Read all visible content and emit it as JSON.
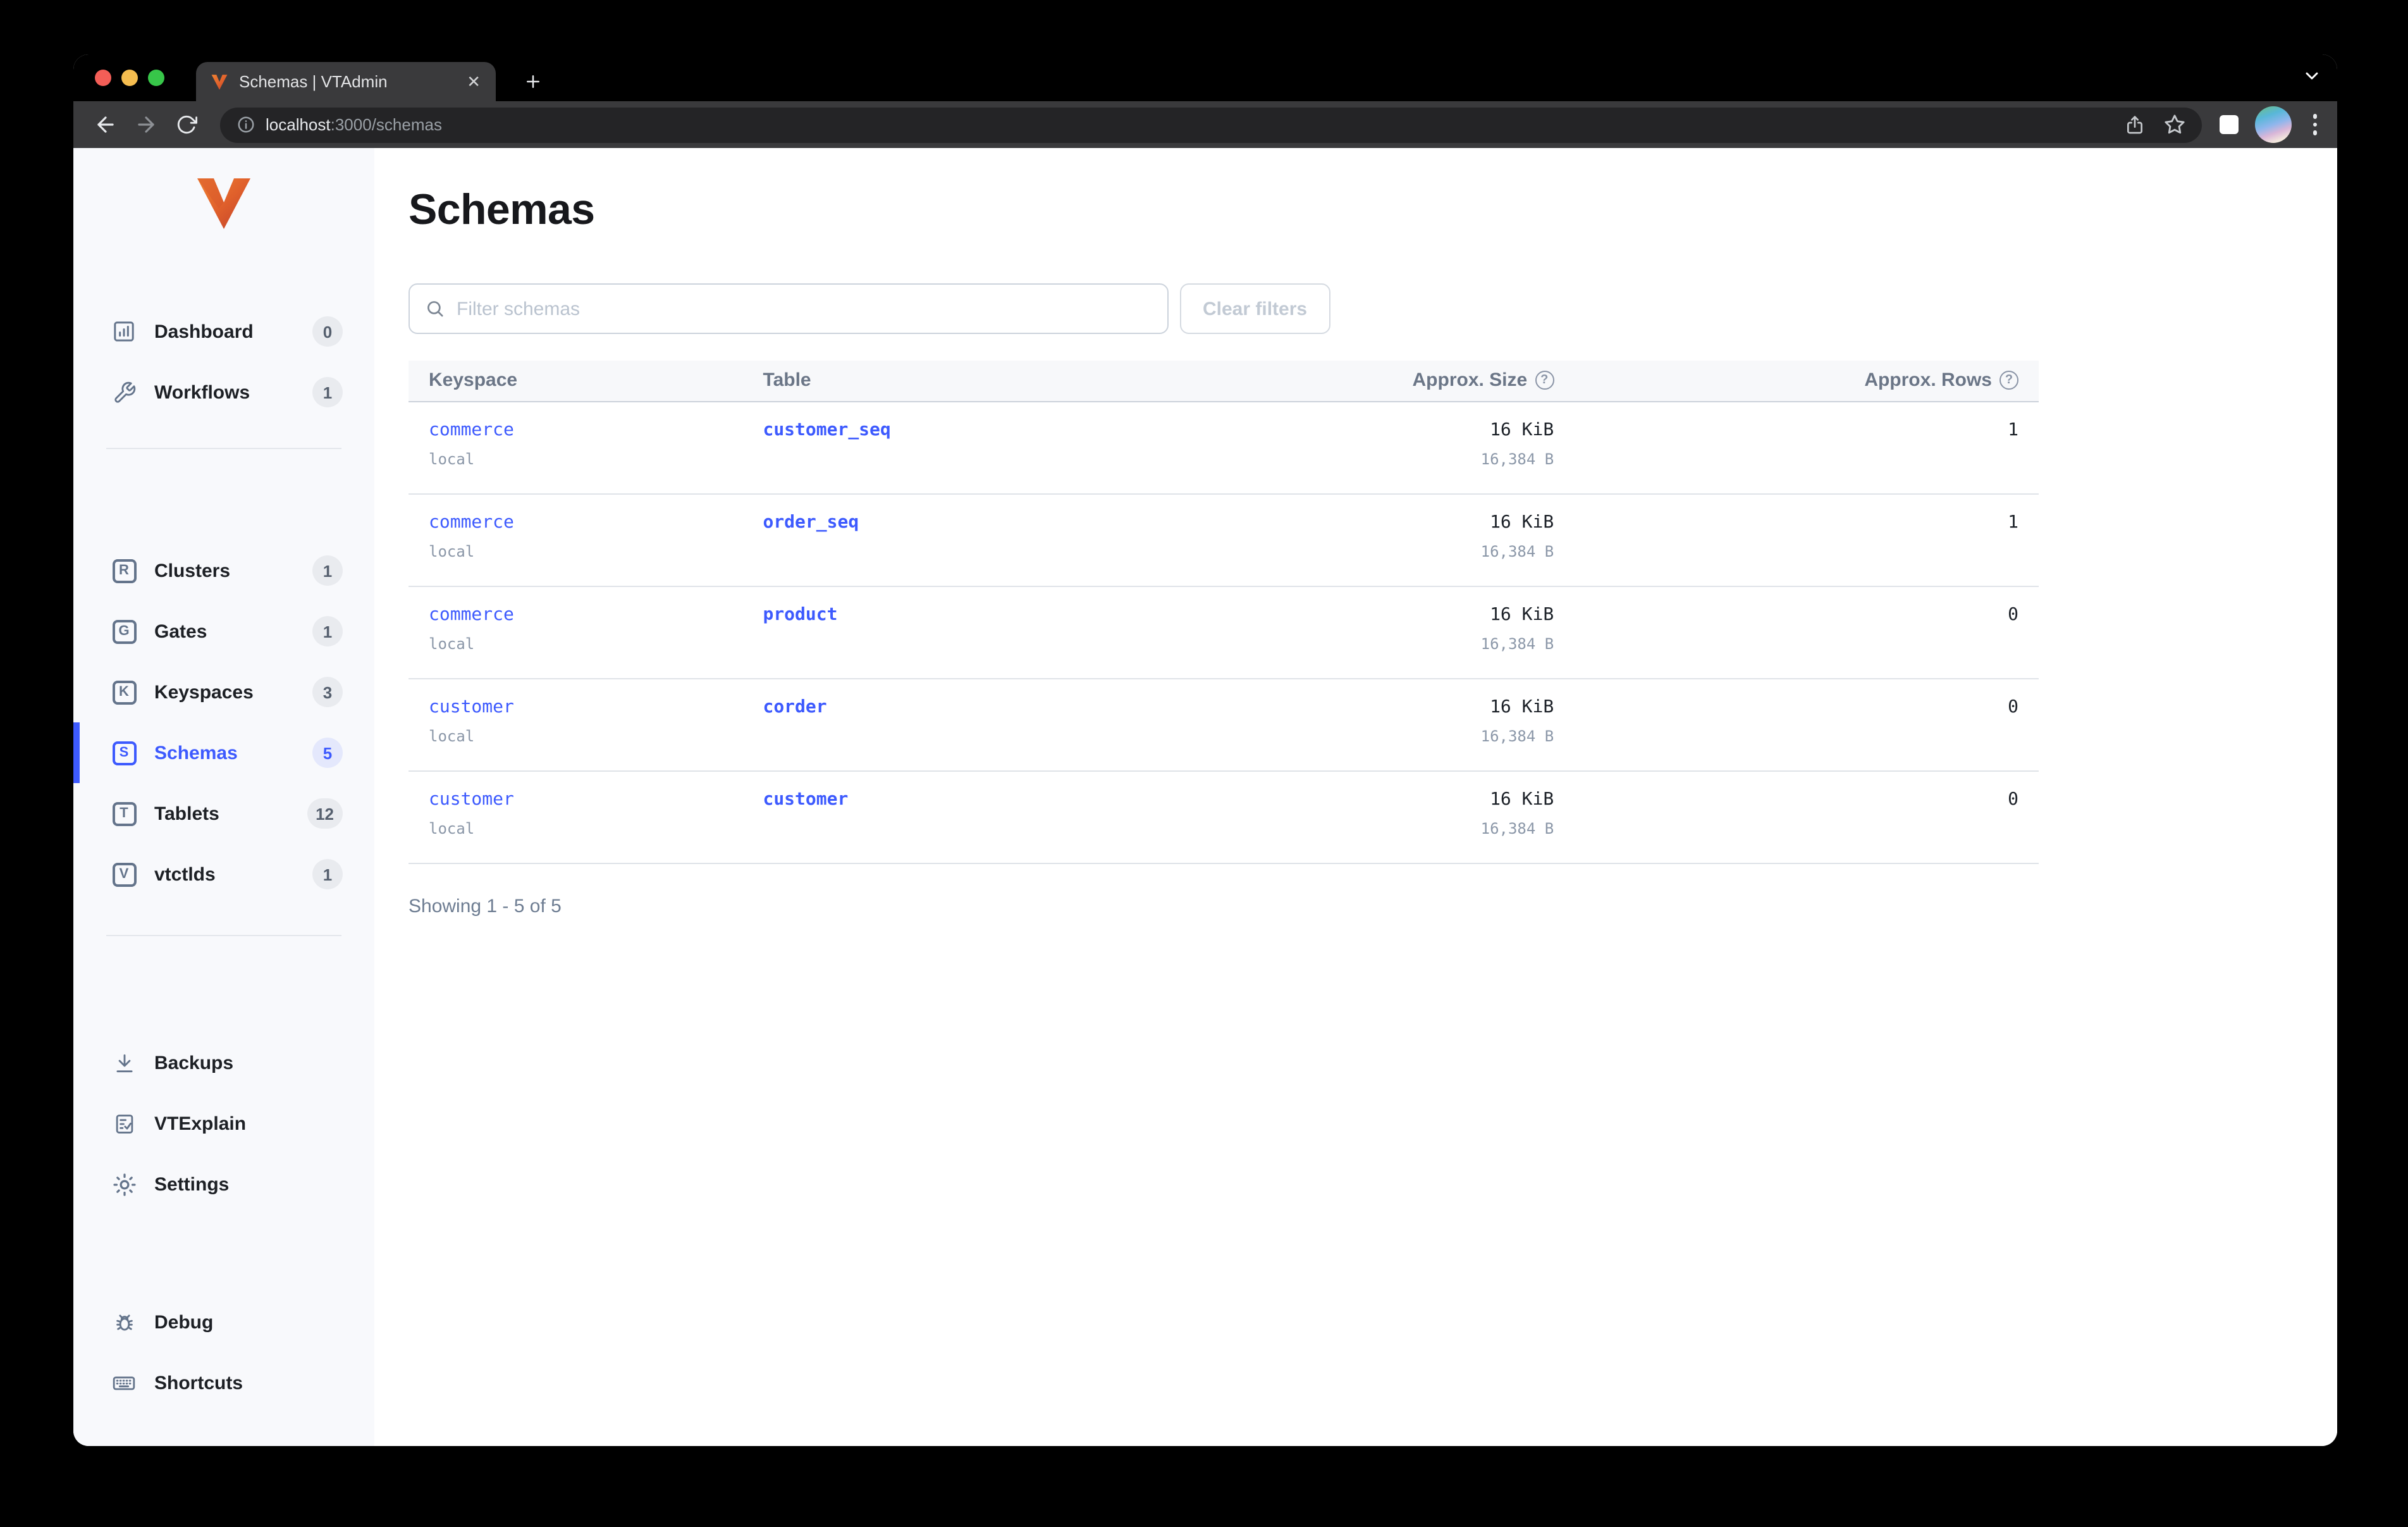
{
  "window": {
    "tab_title": "Schemas | VTAdmin",
    "url_host": "localhost",
    "url_rest": ":3000/schemas"
  },
  "sidebar": {
    "nav_top": [
      {
        "label": "Dashboard",
        "count": "0"
      },
      {
        "label": "Workflows",
        "count": "1"
      }
    ],
    "nav_mid": [
      {
        "letter": "R",
        "label": "Clusters",
        "count": "1"
      },
      {
        "letter": "G",
        "label": "Gates",
        "count": "1"
      },
      {
        "letter": "K",
        "label": "Keyspaces",
        "count": "3"
      },
      {
        "letter": "S",
        "label": "Schemas",
        "count": "5"
      },
      {
        "letter": "T",
        "label": "Tablets",
        "count": "12"
      },
      {
        "letter": "V",
        "label": "vtctlds",
        "count": "1"
      }
    ],
    "nav_tools": [
      {
        "label": "Backups"
      },
      {
        "label": "VTExplain"
      },
      {
        "label": "Settings"
      }
    ],
    "nav_bottom": [
      {
        "label": "Debug"
      },
      {
        "label": "Shortcuts"
      }
    ]
  },
  "main": {
    "title": "Schemas",
    "filter_placeholder": "Filter schemas",
    "clear_button": "Clear filters",
    "table": {
      "headers": [
        "Keyspace",
        "Table",
        "Approx. Size",
        "Approx. Rows"
      ],
      "rows": [
        {
          "keyspace": "commerce",
          "cluster": "local",
          "table": "customer_seq",
          "size": "16 KiB",
          "bytes": "16,384 B",
          "rows": "1"
        },
        {
          "keyspace": "commerce",
          "cluster": "local",
          "table": "order_seq",
          "size": "16 KiB",
          "bytes": "16,384 B",
          "rows": "1"
        },
        {
          "keyspace": "commerce",
          "cluster": "local",
          "table": "product",
          "size": "16 KiB",
          "bytes": "16,384 B",
          "rows": "0"
        },
        {
          "keyspace": "customer",
          "cluster": "local",
          "table": "corder",
          "size": "16 KiB",
          "bytes": "16,384 B",
          "rows": "0"
        },
        {
          "keyspace": "customer",
          "cluster": "local",
          "table": "customer",
          "size": "16 KiB",
          "bytes": "16,384 B",
          "rows": "0"
        }
      ]
    },
    "footer": "Showing 1 - 5 of 5"
  },
  "colors": {
    "accent": "#3d5afe"
  }
}
